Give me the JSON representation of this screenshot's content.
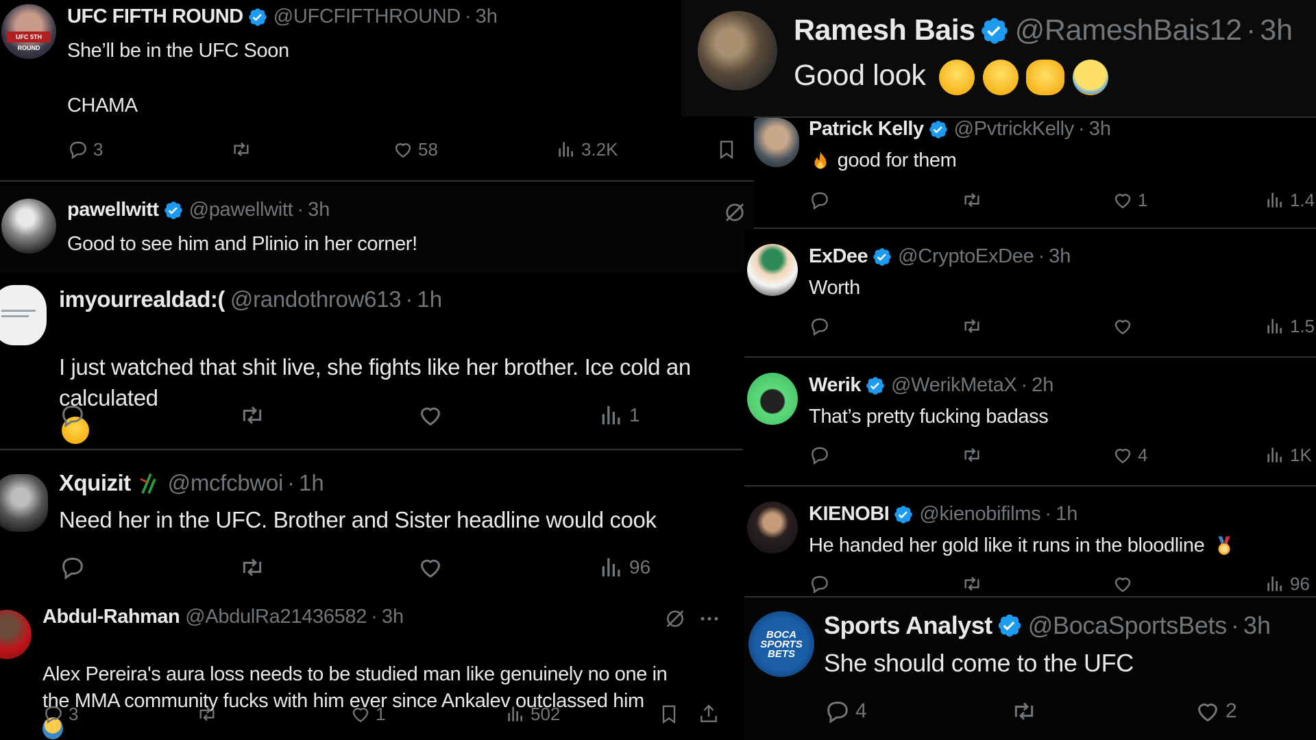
{
  "tweets": [
    {
      "name": "UFC FIFTH ROUND",
      "handle": "@UFCFIFTHROUND",
      "time": "3h",
      "text": "She’ll be in the UFC Soon\n\nCHAMA",
      "replies": "3",
      "likes": "58",
      "views": "3.2K"
    },
    {
      "name": "pawellwitt",
      "handle": "@pawellwitt",
      "time": "3h",
      "text": "Good to see him and Plinio in her corner!"
    },
    {
      "name": "imyourrealdad:(",
      "handle": "@randothrow613",
      "time": "1h",
      "text": "I just watched that shit live, she fights like her brother. Ice cold an\ncalculated",
      "views": "1"
    },
    {
      "name": "Xquizit",
      "handle": "@mcfcbwoi",
      "time": "1h",
      "text": "Need her in the UFC. Brother and Sister headline would cook",
      "views": "96"
    },
    {
      "name": "Abdul-Rahman",
      "handle": "@AbdulRa21436582",
      "time": "3h",
      "text": "Alex Pereira's aura loss needs to be studied man like genuinely no one in\nthe MMA community fucks with him ever since Ankalev outclassed him",
      "replies": "3",
      "likes": "1",
      "views": "502"
    },
    {
      "name": "Ramesh Bais",
      "handle": "@RameshBais12",
      "time": "3h",
      "text": "Good look"
    },
    {
      "name": "Patrick Kelly",
      "handle": "@PvtrickKelly",
      "time": "3h",
      "text": "good for them",
      "likes": "1",
      "views": "1.4"
    },
    {
      "name": "ExDee",
      "handle": "@CryptoExDee",
      "time": "3h",
      "text": "Worth",
      "views": "1.5"
    },
    {
      "name": "Werik",
      "handle": "@WerikMetaX",
      "time": "2h",
      "text": "That’s pretty fucking badass",
      "likes": "4",
      "views": "1K"
    },
    {
      "name": "KIENOBI",
      "handle": "@kienobifilms",
      "time": "1h",
      "text": "He handed her gold like it runs in the bloodline",
      "views": "96"
    },
    {
      "name": "Sports Analyst",
      "handle": "@BocaSportsBets",
      "time": "3h",
      "text": "She should come to the UFC",
      "replies": "4",
      "likes": "2"
    }
  ],
  "avatars": {
    "boca": "BOCA SPORTS BETS",
    "ufc": "UFC 5TH ROUND"
  },
  "colors": {
    "verified": "#1d9bf0",
    "muted": "#71767b",
    "text": "#e7e9ea",
    "divider": "#2f3336",
    "bg": "#000000"
  }
}
